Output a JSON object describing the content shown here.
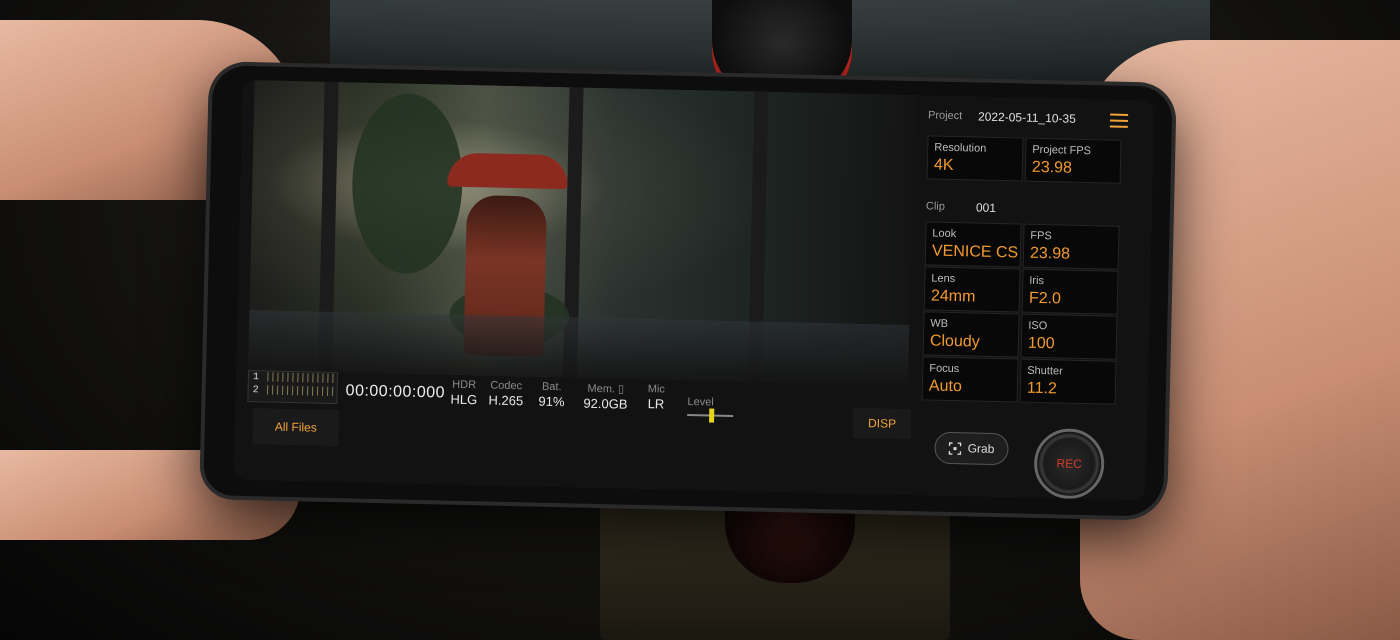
{
  "viewfinder": {
    "meters": {
      "ch1": {
        "label": "1",
        "bars": "||||||||||||||"
      },
      "ch2": {
        "label": "2",
        "bars": "||||||||||||||"
      }
    },
    "timecode": "00:00:00:000",
    "stats": [
      {
        "label": "HDR",
        "value": "HLG"
      },
      {
        "label": "Codec",
        "value": "H.265"
      },
      {
        "label": "Bat.",
        "value": "91%"
      },
      {
        "label": "Mem. ▯",
        "value": "92.0GB"
      },
      {
        "label": "Mic",
        "value": "LR"
      }
    ],
    "level": {
      "label": "Level"
    }
  },
  "buttons": {
    "all_files": "All Files",
    "disp": "DISP",
    "grab": "Grab",
    "rec": "REC"
  },
  "panel": {
    "project": {
      "label": "Project",
      "value": "2022-05-11_10-35"
    },
    "resolution": {
      "label": "Resolution",
      "value": "4K"
    },
    "project_fps": {
      "label": "Project FPS",
      "value": "23.98"
    },
    "clip": {
      "label": "Clip",
      "value": "001"
    },
    "look": {
      "label": "Look",
      "value": "VENICE CS"
    },
    "fps": {
      "label": "FPS",
      "value": "23.98"
    },
    "lens": {
      "label": "Lens",
      "value": "24mm"
    },
    "iris": {
      "label": "Iris",
      "value": "F2.0"
    },
    "wb": {
      "label": "WB",
      "value": "Cloudy"
    },
    "iso": {
      "label": "ISO",
      "value": "100"
    },
    "focus": {
      "label": "Focus",
      "value": "Auto"
    },
    "shutter": {
      "label": "Shutter",
      "value": "11.2"
    }
  },
  "colors": {
    "accent": "#f39a2e",
    "rec": "#d83a2b",
    "level_indicator": "#e6d51a"
  },
  "icons": {
    "menu": "hamburger-menu-icon",
    "grab": "grab-frame-icon"
  }
}
